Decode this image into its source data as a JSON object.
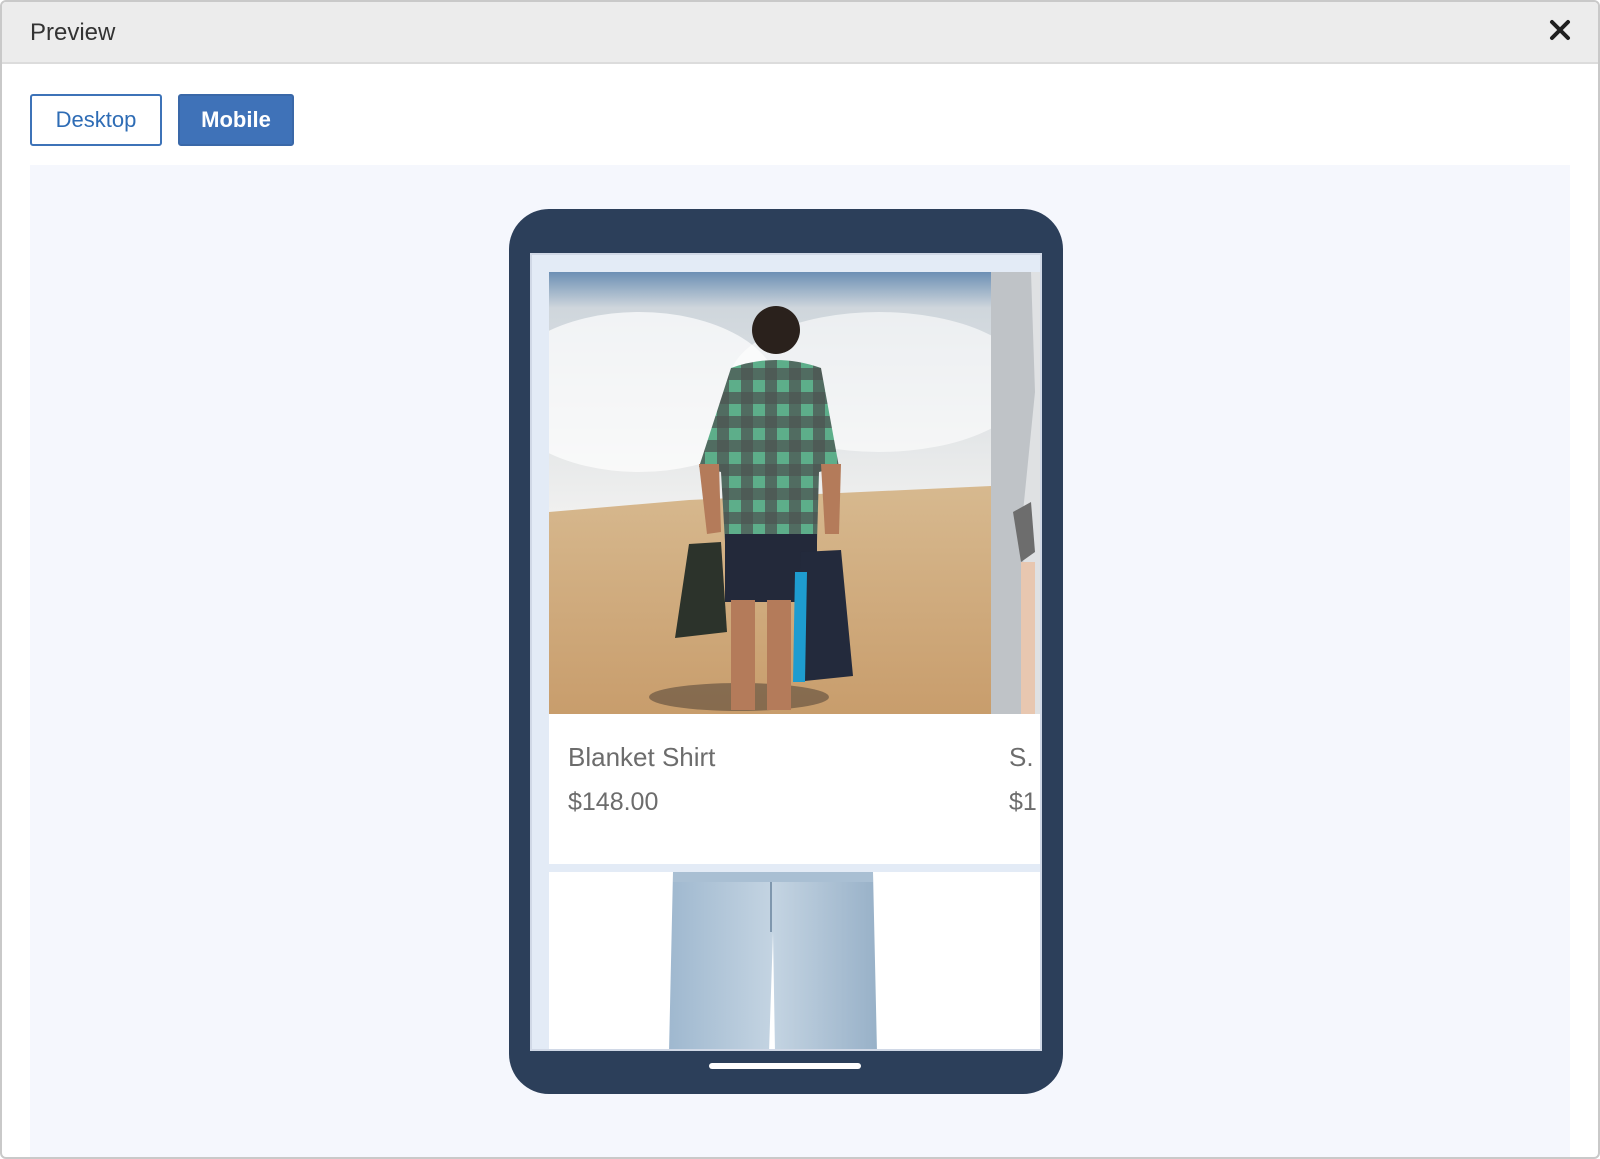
{
  "dialog": {
    "title": "Preview",
    "close_icon": "close-icon"
  },
  "view_toggle": {
    "desktop_label": "Desktop",
    "mobile_label": "Mobile",
    "selected": "Mobile"
  },
  "colors": {
    "accent": "#3f72b8",
    "device_frame": "#2c3f5a",
    "stage_bg": "#f5f7fd"
  },
  "products": [
    {
      "name": "Blanket Shirt",
      "price": "$148.00"
    },
    {
      "name": "S.",
      "price": "$1"
    }
  ]
}
